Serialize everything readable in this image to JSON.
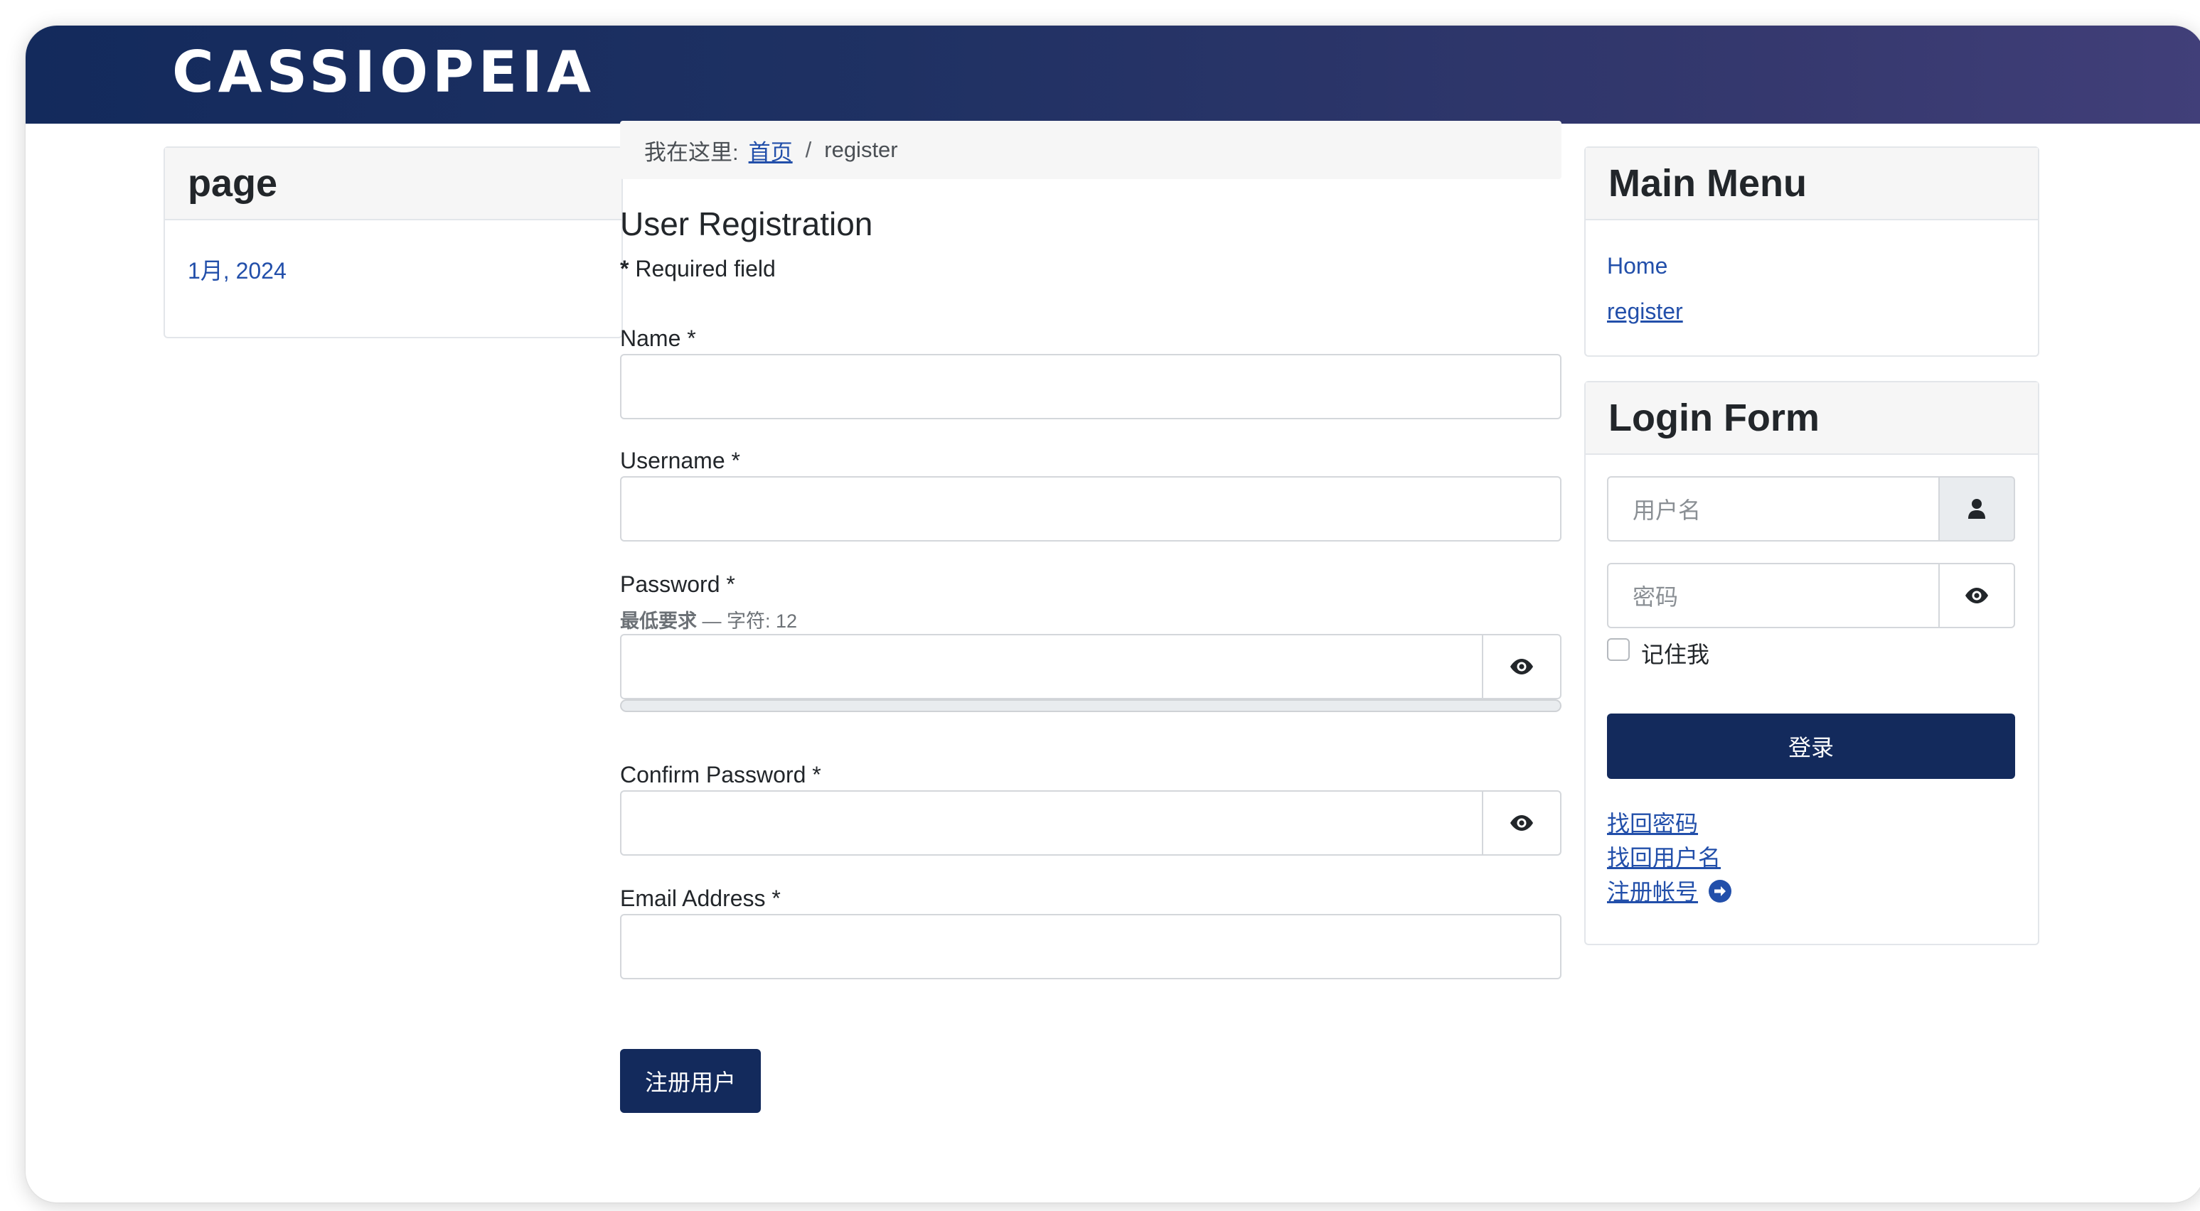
{
  "header": {
    "brand": "CASSIOPEIA"
  },
  "left_module": {
    "title": "page",
    "link": "1月, 2024"
  },
  "breadcrumb": {
    "prefix": "我在这里:",
    "home": "首页",
    "separator": "/",
    "current": "register"
  },
  "registration": {
    "title": "User Registration",
    "required_star": "*",
    "required_note": "Required field",
    "fields": {
      "name": {
        "label": "Name *",
        "value": ""
      },
      "username": {
        "label": "Username *",
        "value": ""
      },
      "password": {
        "label": "Password *",
        "hint_bold": "最低要求",
        "hint_rest": " — 字符: 12",
        "value": "",
        "strength": 0
      },
      "confirm_password": {
        "label": "Confirm Password *",
        "value": ""
      },
      "email": {
        "label": "Email Address *",
        "value": ""
      }
    },
    "submit_label": "注册用户",
    "toggle_icon": "eye-icon"
  },
  "main_menu": {
    "title": "Main Menu",
    "items": [
      {
        "label": "Home",
        "active": false
      },
      {
        "label": "register",
        "active": true
      }
    ]
  },
  "login_form": {
    "title": "Login Form",
    "username_placeholder": "用户名",
    "username_icon": "user-icon",
    "password_placeholder": "密码",
    "password_icon": "eye-icon",
    "remember_label": "记住我",
    "remember_checked": false,
    "login_label": "登录",
    "links": {
      "forgot_password": "找回密码",
      "forgot_username": "找回用户名",
      "register": "注册帐号"
    },
    "register_icon": "arrow-right-circle-icon"
  },
  "colors": {
    "primary": "#132a5c",
    "link": "#224faa",
    "header_gradient_start": "#132a5c",
    "header_gradient_end": "#413f79"
  }
}
